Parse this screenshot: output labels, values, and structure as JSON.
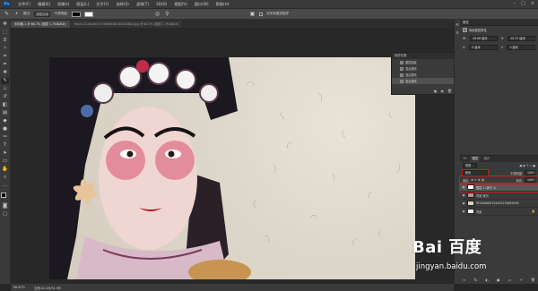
{
  "app": {
    "logo": "Ps"
  },
  "menu": [
    "文件(F)",
    "编辑(E)",
    "图像(I)",
    "图层(L)",
    "文字(Y)",
    "选择(S)",
    "滤镜(T)",
    "3D(D)",
    "视图(V)",
    "窗口(W)",
    "帮助(H)"
  ],
  "window_buttons": [
    "–",
    "□",
    "×"
  ],
  "options": {
    "mode_label": "模式:",
    "mode_value": "线性加深",
    "opacity_label": "不透明度:",
    "fg_swatch": "#000000",
    "bg_swatch": "#ffffff",
    "checkbox_label": "对所有图层取样"
  },
  "tabs": [
    {
      "label": "未标题-1 @ 66.7% (图层 1, RGB/8#)",
      "active": true
    },
    {
      "label": "9b45c2110a4e5c1736b5e06142d2d6b2ljpg @ 66.7% (图层 1, RGB/8#)",
      "active": false
    }
  ],
  "history": {
    "title": "历史记录",
    "items": [
      {
        "label": "图层面板",
        "active": false
      },
      {
        "label": "混合更改",
        "active": false
      },
      {
        "label": "混合更改",
        "active": false
      },
      {
        "label": "混合更改",
        "active": true
      }
    ],
    "footer_icons": [
      "▣",
      "◉",
      "🗑"
    ]
  },
  "properties": {
    "title": "属性",
    "sub_label": "像素图层属性",
    "w_label": "W:",
    "w_value": "36.68 厘米",
    "h_label": "H:",
    "h_value": "20.37 厘米",
    "x_label": "X:",
    "x_value": "0 厘米",
    "y_label": "Y:",
    "y_value": "0 厘米"
  },
  "layers": {
    "tabs": [
      {
        "label": "3D",
        "active": false
      },
      {
        "label": "图层",
        "active": true
      },
      {
        "label": "通道",
        "active": false
      }
    ],
    "kind_label": "类型",
    "blend_value": "颜色",
    "opacity_label": "不透明度:",
    "opacity_value": "100%",
    "lock_label": "锁定:",
    "fill_label": "填充:",
    "fill_value": "100%",
    "items": [
      {
        "name": "图层 1 (拷贝 2)",
        "active": true,
        "thumb": "#ffffff",
        "lock": false
      },
      {
        "name": "背景 拷贝",
        "active": false,
        "thumb": "#c98b8b",
        "lock": false
      },
      {
        "name": "9f12b6d85152e0527b894934",
        "active": false,
        "thumb": "#d8d2c6",
        "lock": false
      },
      {
        "name": "背景",
        "active": false,
        "thumb": "#ffffff",
        "lock": true
      }
    ],
    "footer_icons": [
      "∞",
      "fx",
      "◐",
      "●",
      "▭",
      "+",
      "🗑"
    ]
  },
  "status": {
    "zoom": "66.67%",
    "doc_info": "文档:12.2M/31.9M"
  },
  "watermark": {
    "brand": "Bai 百度",
    "url": "jingyan.baidu.com"
  }
}
